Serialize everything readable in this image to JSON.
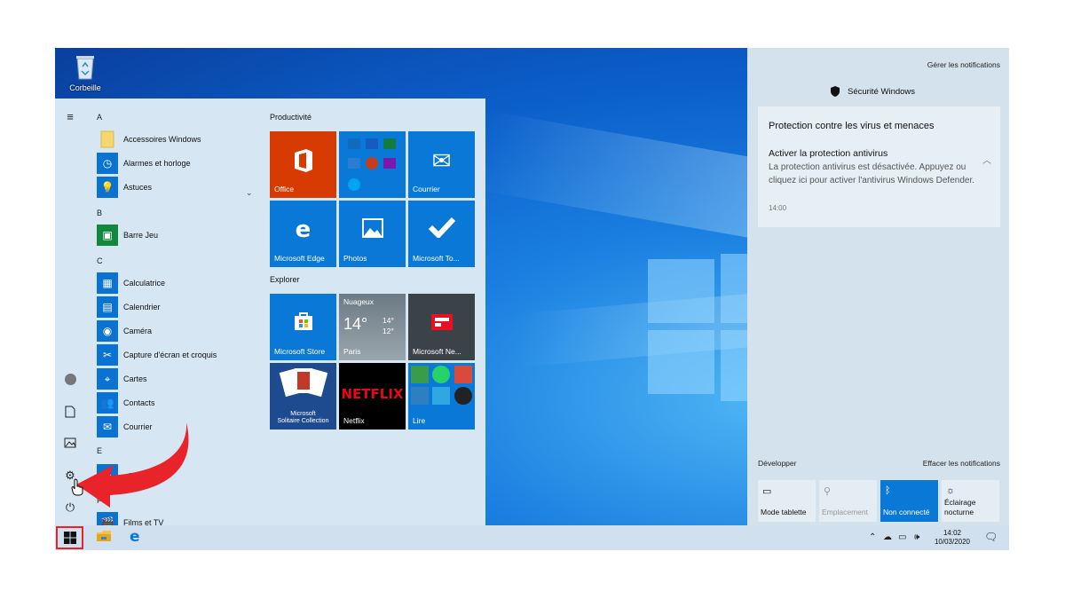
{
  "desktop": {
    "recycle_bin_label": "Corbeille"
  },
  "start_menu": {
    "letters": [
      "A",
      "B",
      "C",
      "E",
      "F"
    ],
    "apps": [
      {
        "label": "Accessoires Windows",
        "icon": "folder-icon"
      },
      {
        "label": "Alarmes et horloge",
        "icon": "clock-icon"
      },
      {
        "label": "Astuces",
        "icon": "lightbulb-icon"
      },
      {
        "label": "Barre Jeu",
        "icon": "xbox-game-bar-icon"
      },
      {
        "label": "Calculatrice",
        "icon": "calculator-icon"
      },
      {
        "label": "Calendrier",
        "icon": "calendar-icon"
      },
      {
        "label": "Caméra",
        "icon": "camera-icon"
      },
      {
        "label": "Capture d'écran et croquis",
        "icon": "snip-icon"
      },
      {
        "label": "Cartes",
        "icon": "map-pin-icon"
      },
      {
        "label": "Contacts",
        "icon": "people-icon"
      },
      {
        "label": "Courrier",
        "icon": "mail-icon"
      },
      {
        "label": "r vocal",
        "icon": "microphone-icon"
      },
      {
        "label": "Films et TV",
        "icon": "film-icon"
      }
    ],
    "groups": {
      "productivity": "Productivité",
      "explore": "Explorer"
    },
    "tiles": {
      "office": "Office",
      "courrier": "Courrier",
      "edge": "Microsoft Edge",
      "photos": "Photos",
      "todo": "Microsoft To...",
      "store": "Microsoft Store",
      "weather_condition": "Nuageux",
      "weather_temp": "14°",
      "weather_high": "14°",
      "weather_low": "12°",
      "weather_city": "Paris",
      "news": "Microsoft Ne...",
      "solitaire_line1": "Microsoft",
      "solitaire_line2": "Solitaire Collection",
      "netflix": "Netflix",
      "netflix_logo": "NETFLIX",
      "play": "Lire"
    }
  },
  "action_center": {
    "manage": "Gérer les notifications",
    "app_title": "Sécurité Windows",
    "notif_header": "Protection contre les virus et menaces",
    "notif_title": "Activer la protection antivirus",
    "notif_body": "La protection antivirus est désactivée. Appuyez ou cliquez ici pour activer l'antivirus Windows Defender.",
    "notif_time": "14:00",
    "expand": "Développer",
    "clear": "Effacer les notifications",
    "quick_actions": [
      {
        "label": "Mode tablette",
        "icon": "tablet-mode-icon"
      },
      {
        "label": "Emplacement",
        "icon": "location-icon"
      },
      {
        "label": "Non connecté",
        "icon": "bluetooth-icon"
      },
      {
        "label_line1": "Éclairage",
        "label_line2": "nocturne",
        "icon": "night-light-icon"
      }
    ]
  },
  "taskbar": {
    "time": "14:02",
    "date": "10/03/2020"
  },
  "colors": {
    "accent": "#0a78d7",
    "office": "#d83b01",
    "netflix": "#000000",
    "annotation_arrow": "#e8232a"
  }
}
